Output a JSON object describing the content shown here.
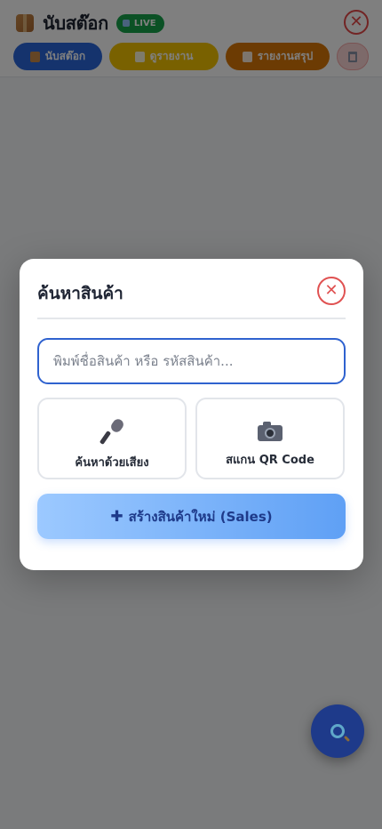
{
  "header": {
    "app_title": "นับสต๊อก",
    "live_label": "LIVE",
    "box_icon": "package-icon",
    "close_symbol": "✕"
  },
  "nav": {
    "stock_label": "นับสต๊อก",
    "view_label": "ดูรายงาน",
    "summary_label": "รายงานสรุป",
    "trash_icon": "trash-icon"
  },
  "modal": {
    "title": "ค้นหาสินค้า",
    "close_symbol": "✕",
    "search_placeholder": "พิมพ์ชื่อสินค้า หรือ รหัสสินค้า...",
    "search_value": "",
    "voice_label": "ค้นหาด้วยเสียง",
    "voice_icon": "microphone-icon",
    "scan_label": "สแกน QR Code",
    "scan_icon": "camera-icon",
    "create_symbol": "✚",
    "create_label": "สร้างสินค้าใหม่ (Sales)"
  },
  "fab": {
    "icon": "magnifier-icon"
  },
  "colors": {
    "primary": "#2a66db",
    "warning": "#f2c200",
    "orange": "#d97706",
    "danger": "#e05252",
    "live": "#16a34a"
  }
}
